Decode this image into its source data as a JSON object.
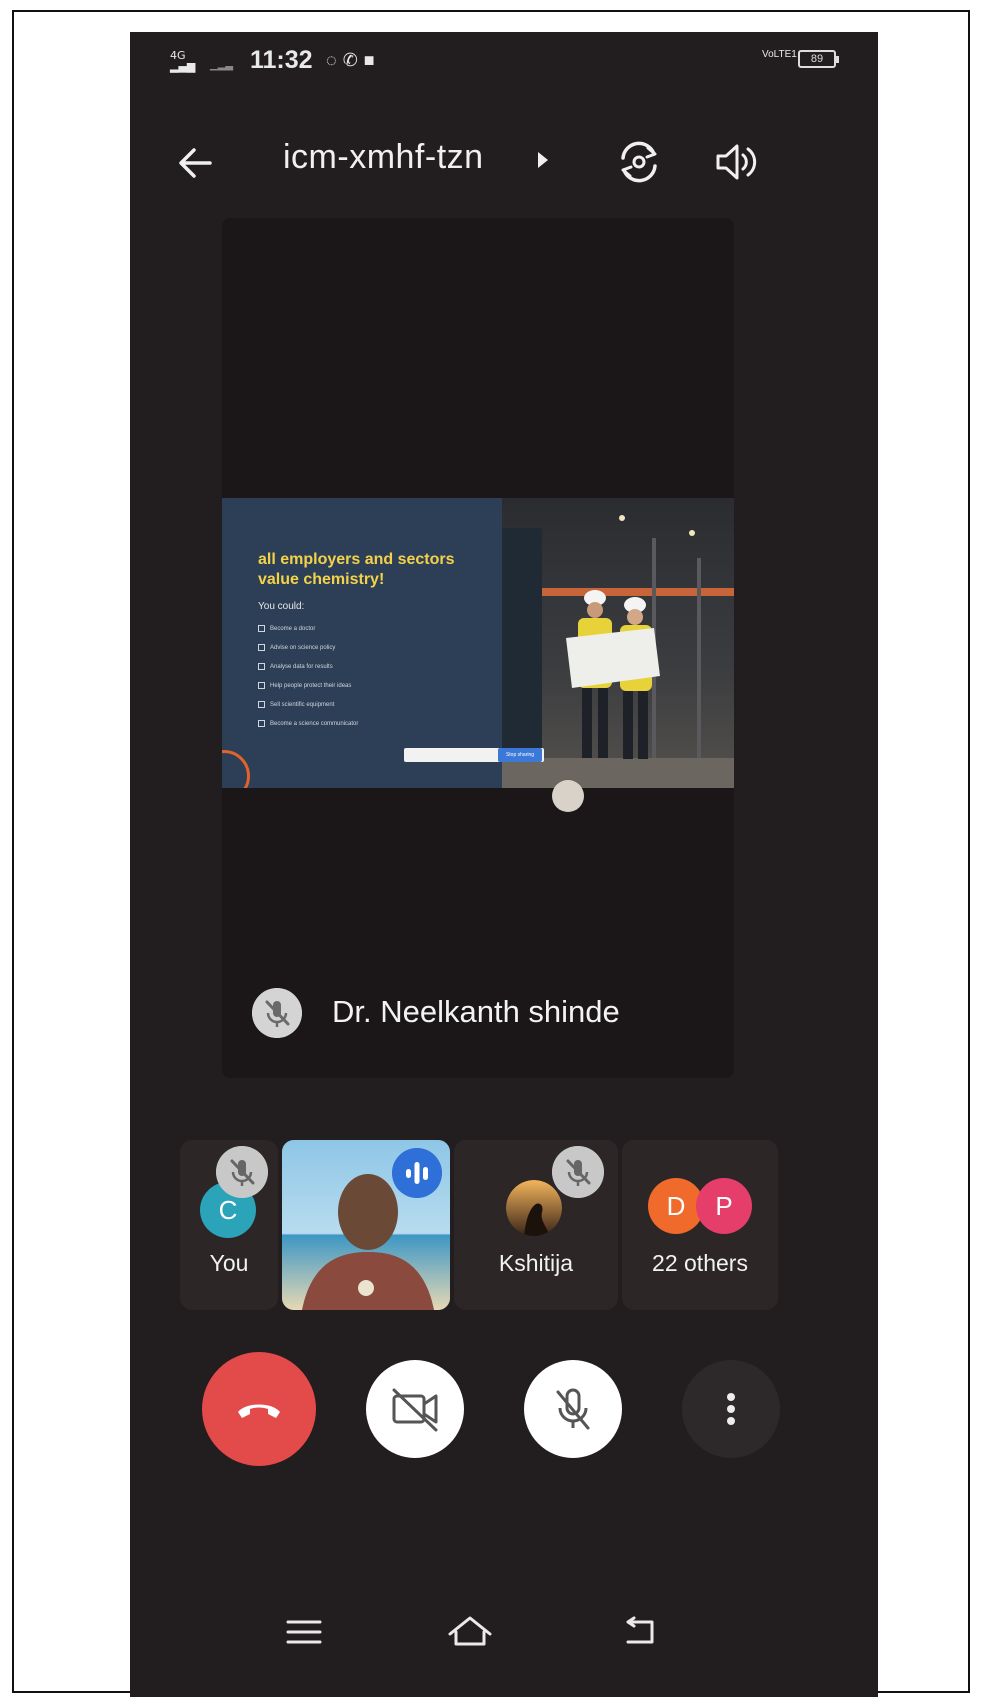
{
  "status_bar": {
    "network": "4G",
    "time": "11:32",
    "volte": "VoLTE1",
    "battery": "89"
  },
  "meeting": {
    "code": "icm-xmhf-tzn"
  },
  "presentation": {
    "slide_title": "all employers and sectors value chemistry!",
    "slide_subtitle": "You could:",
    "slide_items": [
      "Become a doctor",
      "Advise on science policy",
      "Analyse data for results",
      "Help people protect their ideas",
      "Sell scientific equipment",
      "Become a science communicator"
    ],
    "share_button": "Stop sharing"
  },
  "presenter": {
    "name": "Dr. Neelkanth shinde"
  },
  "participants": [
    {
      "label": "You",
      "initial": "C",
      "color": "#2ba3b8",
      "muted": true
    },
    {
      "label": "",
      "video": true,
      "speaking": true
    },
    {
      "label": "Kshitija",
      "muted": true
    },
    {
      "label": "22 others",
      "initials": [
        "D",
        "P"
      ],
      "colors": [
        "#f06a2c",
        "#e53e6a"
      ]
    }
  ],
  "controls": {
    "end_call_color": "#e34a4a"
  }
}
